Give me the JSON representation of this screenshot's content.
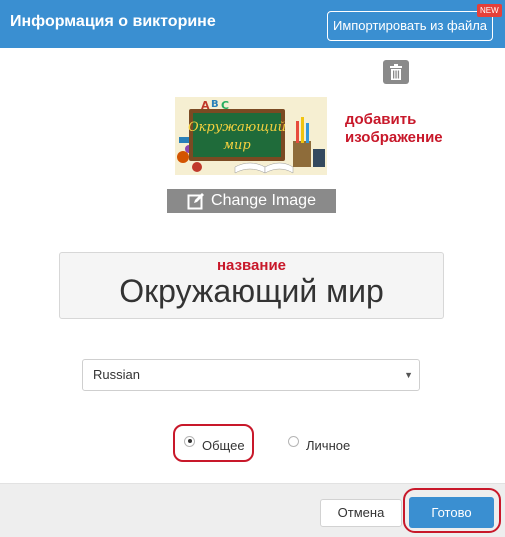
{
  "header": {
    "title": "Информация о викторине",
    "import_label": "Импортировать из файла",
    "new_badge": "NEW",
    "bg_color": "#3a8fd1"
  },
  "image_section": {
    "trash_icon": "trash-icon",
    "image_text_line1": "Окружающий",
    "image_text_line2": "мир",
    "annotation": "добавить изображение",
    "change_image_label": "Change Image",
    "edit_icon": "edit-icon"
  },
  "title_section": {
    "annotation": "название",
    "value": "Окружающий мир"
  },
  "language_select": {
    "selected": "Russian"
  },
  "visibility": {
    "options": [
      {
        "label": "Общее",
        "checked": true
      },
      {
        "label": "Личное",
        "checked": false
      }
    ]
  },
  "footer": {
    "cancel_label": "Отмена",
    "done_label": "Готово"
  },
  "colors": {
    "accent": "#3a8fd1",
    "annotation_red": "#c8182a",
    "gray_button": "#8a8a8a"
  }
}
